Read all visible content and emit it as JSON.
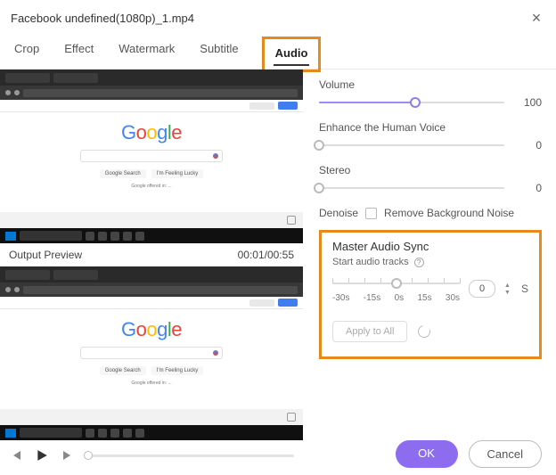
{
  "window": {
    "title": "Facebook undefined(1080p)_1.mp4"
  },
  "tabs": {
    "crop": "Crop",
    "effect": "Effect",
    "watermark": "Watermark",
    "subtitle": "Subtitle",
    "audio": "Audio",
    "active": "audio"
  },
  "preview": {
    "logo_g": "G",
    "logo_o1": "o",
    "logo_o2": "o",
    "logo_g2": "g",
    "logo_l": "l",
    "logo_e": "e",
    "btn1": "Google Search",
    "btn2": "I'm Feeling Lucky",
    "lang": "Google offered in: ..."
  },
  "output": {
    "label": "Output Preview",
    "time": "00:01/00:55"
  },
  "audio": {
    "volume": {
      "label": "Volume",
      "value": "100",
      "percent": 100
    },
    "enhance": {
      "label": "Enhance the Human Voice",
      "value": "0",
      "percent": 0
    },
    "stereo": {
      "label": "Stereo",
      "value": "0",
      "percent": 0
    },
    "denoise": {
      "label": "Denoise",
      "chk_label": "Remove Background Noise",
      "checked": false
    }
  },
  "sync": {
    "title": "Master Audio Sync",
    "sub": "Start audio tracks",
    "labels": [
      "-30s",
      "-15s",
      "0s",
      "15s",
      "30s"
    ],
    "value": "0",
    "unit": "S",
    "percent": 50,
    "apply": "Apply to All"
  },
  "buttons": {
    "ok": "OK",
    "cancel": "Cancel"
  }
}
